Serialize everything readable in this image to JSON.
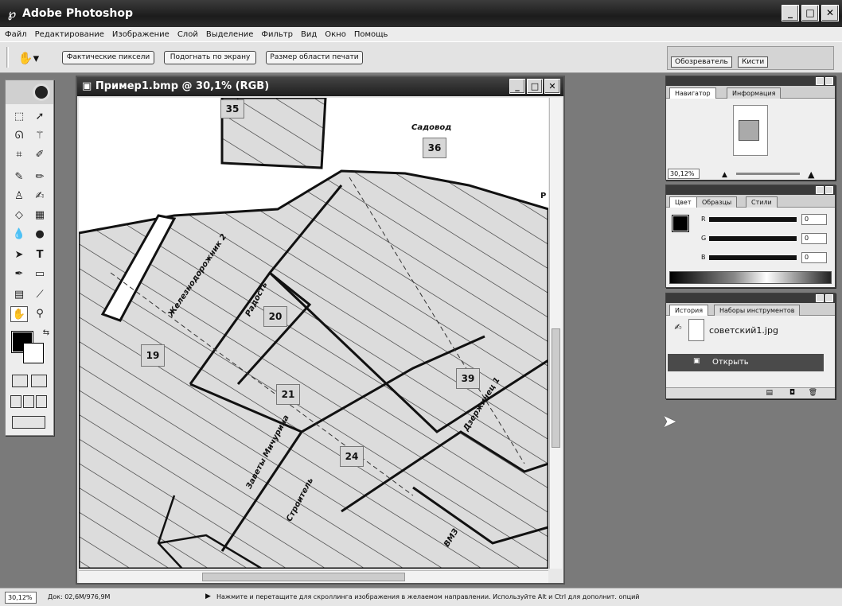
{
  "window": {
    "title": "Adobe Photoshop",
    "app_icon": "ps-icon",
    "buttons": [
      "_",
      "□",
      "✕"
    ]
  },
  "menu": [
    "Файл",
    "Редактирование",
    "Изображение",
    "Слой",
    "Выделение",
    "Фильтр",
    "Вид",
    "Окно",
    "Помощь"
  ],
  "options": {
    "actual_pixels": "Фактические пиксели",
    "fit_screen": "Подогнать по экрану",
    "print_size": "Размер области печати",
    "well_tabs": [
      "Обозреватель",
      "Кисти"
    ]
  },
  "document": {
    "title": "Пример1.bmp @ 30,1% (RGB)",
    "map_labels": {
      "n35": "35",
      "n36": "36",
      "n20": "20",
      "n19": "19",
      "n21": "21",
      "n39": "39",
      "n24": "24",
      "sadovod": "Садовод",
      "radost": "Радость",
      "zheleznodor": "Железнодорожник 2",
      "zavety": "Заветы Мичурина",
      "stroitel": "Строитель",
      "dzerzh": "Дзержинец 1",
      "vmz": "ВМЗ",
      "r": "Р"
    }
  },
  "navigator": {
    "tabs": [
      "Навигатор",
      "Информация"
    ],
    "zoom": "30,12%"
  },
  "color": {
    "tabs": [
      "Цвет",
      "Образцы",
      "Стили"
    ],
    "channels": [
      {
        "label": "R",
        "value": "0"
      },
      {
        "label": "G",
        "value": "0"
      },
      {
        "label": "B",
        "value": "0"
      }
    ]
  },
  "history": {
    "tabs": [
      "История",
      "Наборы инструментов"
    ],
    "snapshot": "советский1.jpg",
    "step": "Открыть"
  },
  "status": {
    "zoom": "30,12%",
    "doc_info": "Док: 02,6M/976,9M",
    "hint": "Нажмите и перетащите для скроллинга изображения в желаемом направлении. Используйте Alt и Ctrl для дополнит. опций"
  }
}
